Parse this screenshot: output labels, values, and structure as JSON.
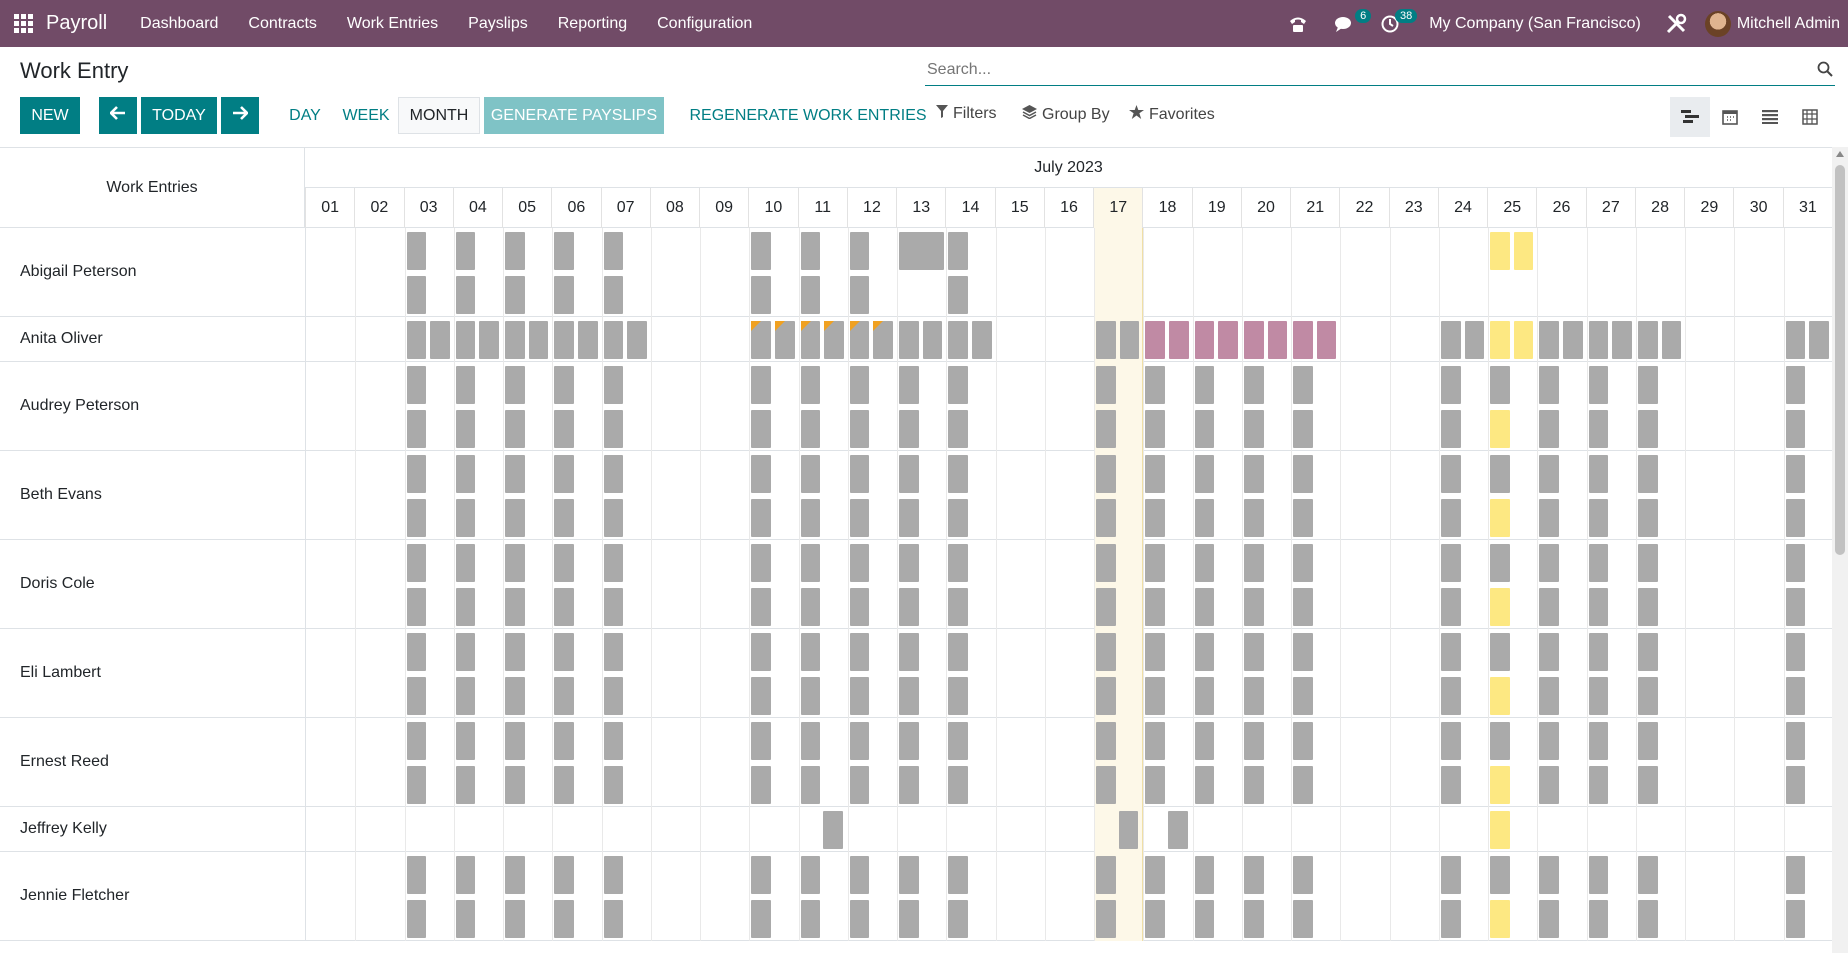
{
  "nav": {
    "app": "Payroll",
    "menu": [
      "Dashboard",
      "Contracts",
      "Work Entries",
      "Payslips",
      "Reporting",
      "Configuration"
    ],
    "messages_count": "6",
    "activities_count": "38",
    "company": "My Company (San Francisco)",
    "user": "Mitchell Admin"
  },
  "page": {
    "title": "Work Entry",
    "search_placeholder": "Search..."
  },
  "toolbar": {
    "new": "NEW",
    "today": "TODAY",
    "day": "DAY",
    "week": "WEEK",
    "month": "MONTH",
    "generate": "GENERATE PAYSLIPS",
    "regenerate": "REGENERATE WORK ENTRIES",
    "filters": "Filters",
    "group_by": "Group By",
    "favorites": "Favorites"
  },
  "gantt": {
    "corner": "Work Entries",
    "month": "July 2023",
    "days": [
      "01",
      "02",
      "03",
      "04",
      "05",
      "06",
      "07",
      "08",
      "09",
      "10",
      "11",
      "12",
      "13",
      "14",
      "15",
      "16",
      "17",
      "18",
      "19",
      "20",
      "21",
      "22",
      "23",
      "24",
      "25",
      "26",
      "27",
      "28",
      "29",
      "30",
      "31"
    ],
    "today_day": 17,
    "rows": [
      {
        "name": "Abigail Peterson",
        "lines": 2,
        "entries": [
          {
            "d": 3,
            "l": 0,
            "c": "gray"
          },
          {
            "d": 4,
            "l": 0,
            "c": "gray"
          },
          {
            "d": 5,
            "l": 0,
            "c": "gray"
          },
          {
            "d": 6,
            "l": 0,
            "c": "gray"
          },
          {
            "d": 7,
            "l": 0,
            "c": "gray"
          },
          {
            "d": 10,
            "l": 0,
            "c": "gray"
          },
          {
            "d": 11,
            "l": 0,
            "c": "gray"
          },
          {
            "d": 12,
            "l": 0,
            "c": "gray"
          },
          {
            "d": 13,
            "l": 0,
            "c": "gray",
            "full": true
          },
          {
            "d": 14,
            "l": 0,
            "c": "gray"
          },
          {
            "d": 3,
            "l": 1,
            "c": "gray"
          },
          {
            "d": 4,
            "l": 1,
            "c": "gray"
          },
          {
            "d": 5,
            "l": 1,
            "c": "gray"
          },
          {
            "d": 6,
            "l": 1,
            "c": "gray"
          },
          {
            "d": 7,
            "l": 1,
            "c": "gray"
          },
          {
            "d": 10,
            "l": 1,
            "c": "gray"
          },
          {
            "d": 11,
            "l": 1,
            "c": "gray"
          },
          {
            "d": 12,
            "l": 1,
            "c": "gray"
          },
          {
            "d": 14,
            "l": 1,
            "c": "gray"
          },
          {
            "d": 25,
            "l": 0,
            "c": "yellow",
            "both": true
          }
        ]
      },
      {
        "name": "Anita Oliver",
        "lines": 1,
        "entries": [
          {
            "d": 3,
            "l": 0,
            "c": "gray",
            "both": true
          },
          {
            "d": 4,
            "l": 0,
            "c": "gray",
            "both": true
          },
          {
            "d": 5,
            "l": 0,
            "c": "gray",
            "both": true
          },
          {
            "d": 6,
            "l": 0,
            "c": "gray",
            "both": true
          },
          {
            "d": 7,
            "l": 0,
            "c": "gray",
            "both": true
          },
          {
            "d": 10,
            "l": 0,
            "c": "gray",
            "both": true,
            "warn": true
          },
          {
            "d": 11,
            "l": 0,
            "c": "gray",
            "both": true,
            "warn": true
          },
          {
            "d": 12,
            "l": 0,
            "c": "gray",
            "both": true,
            "warn": true
          },
          {
            "d": 13,
            "l": 0,
            "c": "gray",
            "both": true
          },
          {
            "d": 14,
            "l": 0,
            "c": "gray",
            "both": true
          },
          {
            "d": 17,
            "l": 0,
            "c": "gray",
            "both": true
          },
          {
            "d": 18,
            "l": 0,
            "c": "pink",
            "both": true
          },
          {
            "d": 19,
            "l": 0,
            "c": "pink",
            "both": true
          },
          {
            "d": 20,
            "l": 0,
            "c": "pink",
            "both": true
          },
          {
            "d": 21,
            "l": 0,
            "c": "pink",
            "both": true
          },
          {
            "d": 24,
            "l": 0,
            "c": "gray",
            "both": true
          },
          {
            "d": 25,
            "l": 0,
            "c": "yellow",
            "both": true
          },
          {
            "d": 26,
            "l": 0,
            "c": "gray",
            "both": true
          },
          {
            "d": 27,
            "l": 0,
            "c": "gray",
            "both": true
          },
          {
            "d": 28,
            "l": 0,
            "c": "gray",
            "both": true
          },
          {
            "d": 31,
            "l": 0,
            "c": "gray",
            "both": true
          }
        ]
      },
      {
        "name": "Audrey Peterson",
        "lines": 2,
        "pattern": "standard"
      },
      {
        "name": "Beth Evans",
        "lines": 2,
        "pattern": "standard"
      },
      {
        "name": "Doris Cole",
        "lines": 2,
        "pattern": "standard"
      },
      {
        "name": "Eli Lambert",
        "lines": 2,
        "pattern": "standard"
      },
      {
        "name": "Ernest Reed",
        "lines": 2,
        "pattern": "standard"
      },
      {
        "name": "Jeffrey Kelly",
        "lines": 1,
        "entries": [
          {
            "d": 11,
            "l": 0,
            "c": "gray",
            "second": true
          },
          {
            "d": 17,
            "l": 0,
            "c": "gray",
            "second": true
          },
          {
            "d": 18,
            "l": 0,
            "c": "gray",
            "second": true
          },
          {
            "d": 25,
            "l": 0,
            "c": "yellow"
          }
        ]
      },
      {
        "name": "Jennie Fletcher",
        "lines": 2,
        "pattern": "standard"
      }
    ]
  }
}
